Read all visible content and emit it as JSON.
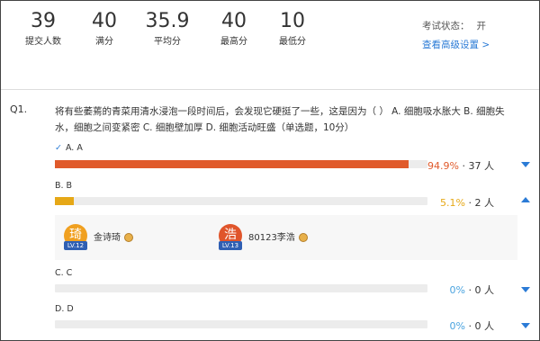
{
  "stats": [
    {
      "value": "39",
      "label": "提交人数"
    },
    {
      "value": "40",
      "label": "满分"
    },
    {
      "value": "35.9",
      "label": "平均分"
    },
    {
      "value": "40",
      "label": "最高分"
    },
    {
      "value": "10",
      "label": "最低分"
    }
  ],
  "exam_status": {
    "label": "考试状态：",
    "value": "开",
    "advanced_link": "查看高级设置 >"
  },
  "question": {
    "number": "Q1.",
    "text": "将有些萎蔫的青菜用清水浸泡一段时间后，会发现它硬挺了一些，这是因为（ ） A. 细胞吸水胀大 B. 细胞失水，细胞之间变紧密 C. 细胞壁加厚 D. 细胞活动旺盛（单选题，10分）"
  },
  "options": [
    {
      "label": "A. A",
      "correct": true,
      "percent_text": "94.9%",
      "count_text": "37 人",
      "fraction": 0.949,
      "color": "#e05a2b",
      "expanded": false
    },
    {
      "label": "B. B",
      "correct": false,
      "percent_text": "5.1%",
      "count_text": "2 人",
      "fraction": 0.051,
      "color": "#e6a817",
      "expanded": true
    },
    {
      "label": "C. C",
      "correct": false,
      "percent_text": "0%",
      "count_text": "0 人",
      "fraction": 0,
      "color": "#4aa3df",
      "expanded": false
    },
    {
      "label": "D. D",
      "correct": false,
      "percent_text": "0%",
      "count_text": "0 人",
      "fraction": 0,
      "color": "#4aa3df",
      "expanded": false
    }
  ],
  "students": [
    {
      "avatar_char": "琦",
      "level": "LV.12",
      "name": "金诗琦",
      "avatar_color": "#f0a020"
    },
    {
      "avatar_char": "浩",
      "level": "LV.13",
      "name": "80123李浩",
      "avatar_color": "#e0552b"
    }
  ],
  "separator": " · ",
  "check_glyph": "✓",
  "icons": {
    "check": "check-icon",
    "expand": "chevron-down-icon",
    "collapse": "chevron-up-icon",
    "medal": "medal-icon"
  }
}
